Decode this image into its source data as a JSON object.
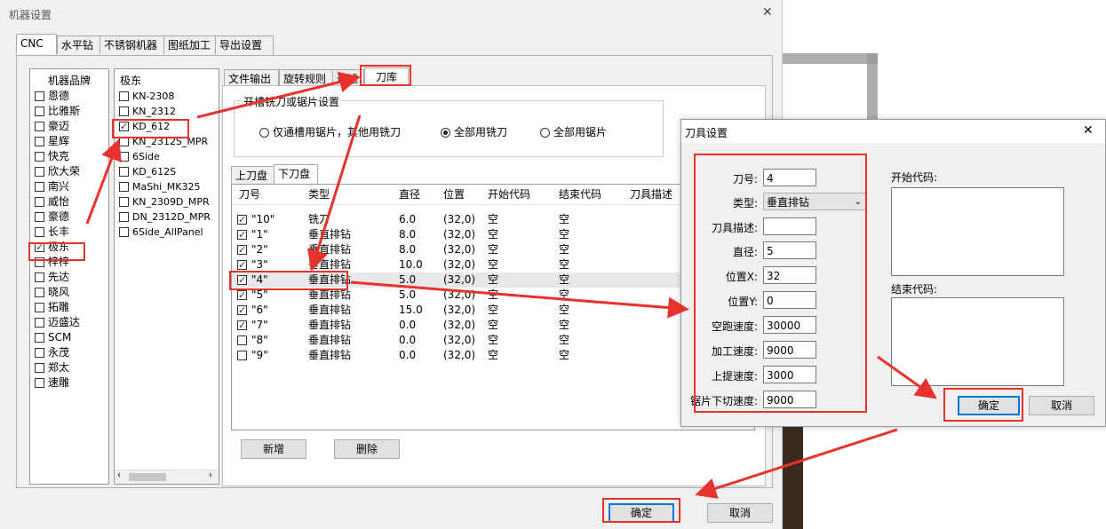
{
  "main_window": {
    "title": "机器设置",
    "close_glyph": "✕",
    "tabs": [
      "CNC",
      "水平钻",
      "不锈钢机器",
      "图纸加工",
      "导出设置"
    ],
    "brand_header": "机器品牌",
    "brands": [
      {
        "name": "恩德",
        "checked": false
      },
      {
        "name": "比雅斯",
        "checked": false
      },
      {
        "name": "豪迈",
        "checked": false
      },
      {
        "name": "星辉",
        "checked": false
      },
      {
        "name": "快克",
        "checked": false
      },
      {
        "name": "欣大荣",
        "checked": false
      },
      {
        "name": "南兴",
        "checked": false
      },
      {
        "name": "威怡",
        "checked": false
      },
      {
        "name": "豪德",
        "checked": false
      },
      {
        "name": "长丰",
        "checked": false
      },
      {
        "name": "极东",
        "checked": true
      },
      {
        "name": "梓梓",
        "checked": false
      },
      {
        "name": "先达",
        "checked": false
      },
      {
        "name": "晓风",
        "checked": false
      },
      {
        "name": "拓雕",
        "checked": false
      },
      {
        "name": "迈盛达",
        "checked": false
      },
      {
        "name": "SCM",
        "checked": false
      },
      {
        "name": "永茂",
        "checked": false
      },
      {
        "name": "郑太",
        "checked": false
      },
      {
        "name": "速雕",
        "checked": false
      }
    ],
    "model_header": "极东",
    "models": [
      {
        "name": "KN-2308",
        "checked": false
      },
      {
        "name": "KN_2312",
        "checked": false
      },
      {
        "name": "KD_612",
        "checked": true
      },
      {
        "name": "KN_2312S_MPR",
        "checked": false
      },
      {
        "name": "6Side",
        "checked": false
      },
      {
        "name": "KD_612S",
        "checked": false
      },
      {
        "name": "MaShi_MK325",
        "checked": false
      },
      {
        "name": "KN_2309D_MPR",
        "checked": false
      },
      {
        "name": "DN_2312D_MPR",
        "checked": false
      },
      {
        "name": "6Side_AllPanel",
        "checked": false
      }
    ],
    "inner_tabs": [
      "文件输出",
      "旋转规则",
      "过滤",
      "刀库"
    ],
    "group_title": "开槽铣刀或锯片设置",
    "radios": [
      {
        "label": "仅通槽用锯片，其他用铣刀",
        "selected": false
      },
      {
        "label": "全部用铣刀",
        "selected": true
      },
      {
        "label": "全部用锯片",
        "selected": false
      }
    ],
    "disk_tabs": [
      "上刀盘",
      "下刀盘"
    ],
    "columns": [
      "刀号",
      "类型",
      "直径",
      "位置",
      "开始代码",
      "结束代码",
      "刀具描述"
    ],
    "rows": [
      {
        "checked": true,
        "no": "\"10\"",
        "type": "铣刀",
        "dia": "6.0",
        "pos": "(32,0)",
        "start": "空",
        "end": "空"
      },
      {
        "checked": true,
        "no": "\"1\"",
        "type": "垂直排钻",
        "dia": "8.0",
        "pos": "(32,0)",
        "start": "空",
        "end": "空"
      },
      {
        "checked": true,
        "no": "\"2\"",
        "type": "垂直排钻",
        "dia": "8.0",
        "pos": "(32,0)",
        "start": "空",
        "end": "空"
      },
      {
        "checked": true,
        "no": "\"3\"",
        "type": "垂直排钻",
        "dia": "10.0",
        "pos": "(32,0)",
        "start": "空",
        "end": "空"
      },
      {
        "checked": true,
        "no": "\"4\"",
        "type": "垂直排钻",
        "dia": "5.0",
        "pos": "(32,0)",
        "start": "空",
        "end": "空"
      },
      {
        "checked": true,
        "no": "\"5\"",
        "type": "垂直排钻",
        "dia": "5.0",
        "pos": "(32,0)",
        "start": "空",
        "end": "空"
      },
      {
        "checked": true,
        "no": "\"6\"",
        "type": "垂直排钻",
        "dia": "15.0",
        "pos": "(32,0)",
        "start": "空",
        "end": "空"
      },
      {
        "checked": true,
        "no": "\"7\"",
        "type": "垂直排钻",
        "dia": "0.0",
        "pos": "(32,0)",
        "start": "空",
        "end": "空"
      },
      {
        "checked": false,
        "no": "\"8\"",
        "type": "垂直排钻",
        "dia": "0.0",
        "pos": "(32,0)",
        "start": "空",
        "end": "空"
      },
      {
        "checked": false,
        "no": "\"9\"",
        "type": "垂直排钻",
        "dia": "0.0",
        "pos": "(32,0)",
        "start": "空",
        "end": "空"
      }
    ],
    "add_label": "新增",
    "delete_label": "删除",
    "ok_label": "确定",
    "cancel_label": "取消"
  },
  "tool_dialog": {
    "title": "刀具设置",
    "close_glyph": "✕",
    "labels": {
      "no": "刀号:",
      "type": "类型:",
      "desc": "刀具描述:",
      "dia": "直径:",
      "posx": "位置X:",
      "posy": "位置Y:",
      "idle_speed": "空跑速度:",
      "feed_speed": "加工速度:",
      "lift_speed": "上提速度:",
      "saw_speed": "锯片下切速度:"
    },
    "values": {
      "no": "4",
      "type": "垂直排钻",
      "desc": "",
      "dia": "5",
      "posx": "32",
      "posy": "0",
      "idle_speed": "30000",
      "feed_speed": "9000",
      "lift_speed": "3000",
      "saw_speed": "9000"
    },
    "start_code_label": "开始代码:",
    "end_code_label": "结束代码:",
    "ok_label": "确定",
    "cancel_label": "取消"
  },
  "colors": {
    "highlight": "#e8322e",
    "accent": "#0078d7"
  }
}
